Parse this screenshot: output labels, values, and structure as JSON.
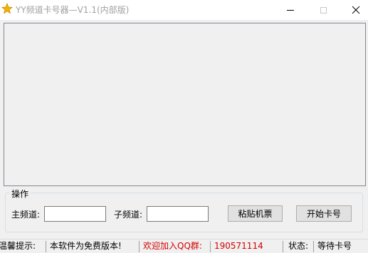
{
  "window": {
    "title": "YY频道卡号器—V1.1(内部版)"
  },
  "operation_group": {
    "legend": "操作",
    "main_channel_label": "主频道:",
    "main_channel_value": "",
    "sub_channel_label": "子频道:",
    "sub_channel_value": "",
    "paste_ticket_label": "粘贴机票",
    "start_label": "开始卡号"
  },
  "statusbar": {
    "tip_label": "温馨提示:",
    "tip_text": "本软件为免费版本!",
    "qq_label": "欢迎加入QQ群:",
    "qq_number": "190571114",
    "status_label": "状态:",
    "status_value": "等待卡号"
  },
  "colors": {
    "highlight": "#d40000",
    "icon_star": "#f5b400"
  },
  "icons": {
    "app": "star-icon",
    "minimize": "minimize-icon",
    "maximize": "maximize-icon",
    "close": "close-icon"
  }
}
